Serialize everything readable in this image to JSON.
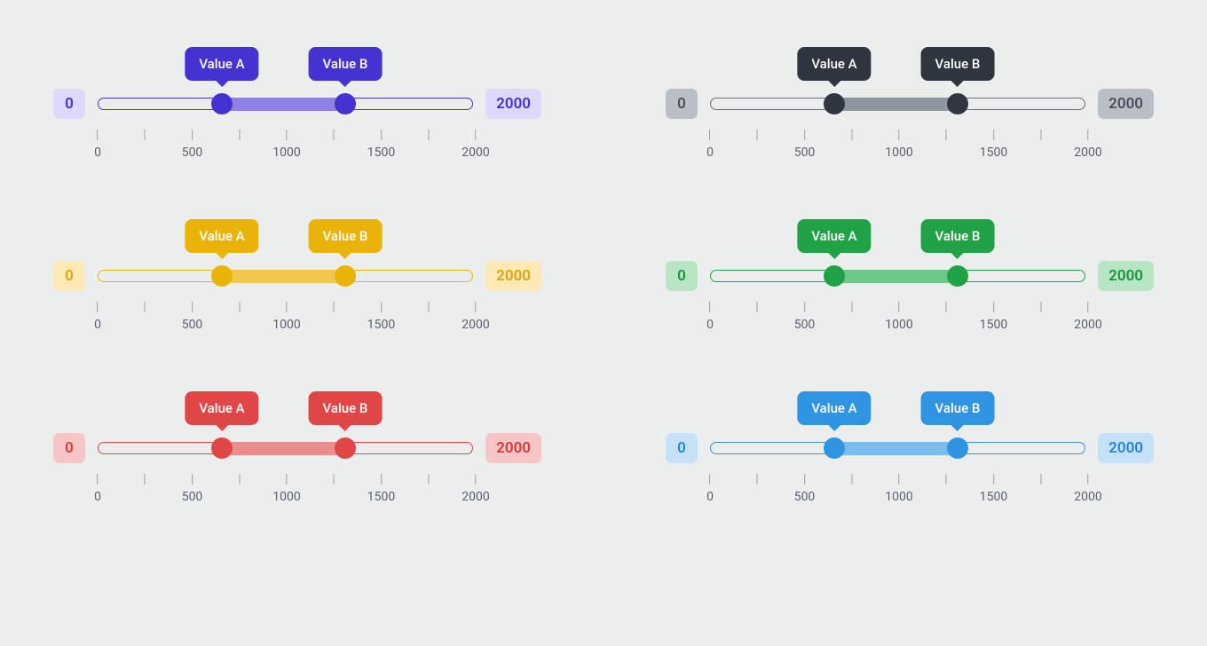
{
  "range": {
    "min_label": "0",
    "max_label": "2000"
  },
  "tooltips": {
    "a": "Value A",
    "b": "Value B"
  },
  "positions": {
    "a_percent": 33,
    "b_percent": 66
  },
  "ticks": [
    {
      "pos": 0,
      "label": "0"
    },
    {
      "pos": 12.5,
      "label": ""
    },
    {
      "pos": 25,
      "label": "500"
    },
    {
      "pos": 37.5,
      "label": ""
    },
    {
      "pos": 50,
      "label": "1000"
    },
    {
      "pos": 62.5,
      "label": ""
    },
    {
      "pos": 75,
      "label": "1500"
    },
    {
      "pos": 87.5,
      "label": ""
    },
    {
      "pos": 100,
      "label": "2000"
    }
  ],
  "themes": [
    {
      "name": "violet",
      "accent": "#4333d1",
      "fill": "#8d82e3",
      "badge_bg": "#ded9fc",
      "badge_fg": "#4333d1",
      "track_border": "#4333d1"
    },
    {
      "name": "gray",
      "accent": "#2f3640",
      "fill": "#8f969f",
      "badge_bg": "#babfc6",
      "badge_fg": "#4a515c",
      "track_border": "#6a7079"
    },
    {
      "name": "amber",
      "accent": "#eab308",
      "fill": "#f1c84b",
      "badge_bg": "#fce9b6",
      "badge_fg": "#dfa406",
      "track_border": "#eab308"
    },
    {
      "name": "green",
      "accent": "#22a247",
      "fill": "#6ec989",
      "badge_bg": "#b8e6c5",
      "badge_fg": "#1e9340",
      "track_border": "#22a247"
    },
    {
      "name": "red",
      "accent": "#e14646",
      "fill": "#ec8d8d",
      "badge_bg": "#f6c5c5",
      "badge_fg": "#d93a3a",
      "track_border": "#e14646"
    },
    {
      "name": "blue",
      "accent": "#2f95e3",
      "fill": "#79bdf0",
      "badge_bg": "#c5e1f8",
      "badge_fg": "#2787d2",
      "track_border": "#2f95e3"
    }
  ]
}
